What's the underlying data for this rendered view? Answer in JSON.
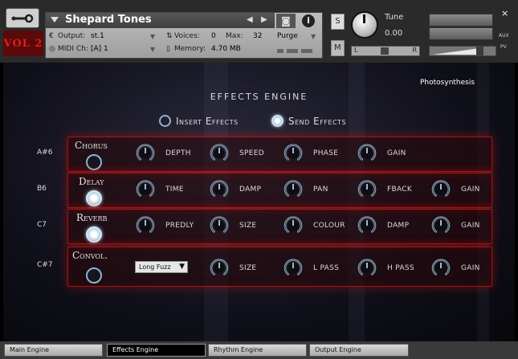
{
  "header": {
    "logo_text": "VOL 2",
    "instrument_name": "Shepard Tones",
    "output_label": "Output:",
    "output_value": "st.1",
    "voices_label": "Voices:",
    "voices_value": "0",
    "max_label": "Max:",
    "max_value": "32",
    "purge_label": "Purge",
    "midi_label": "MIDI Ch:",
    "midi_value": "[A]  1",
    "memory_label": "Memory:",
    "memory_value": "4.70 MB",
    "solo_label": "S",
    "mute_label": "M",
    "tune_label": "Tune",
    "tune_value": "0.00",
    "pan_left": "L",
    "pan_right": "R",
    "aux_label": "AUX",
    "pv_label": "PV",
    "close_glyph": "×"
  },
  "main": {
    "brand": "Photosynthesis",
    "title": "EFFECTS ENGINE",
    "insert_label": "Insert Effects",
    "send_label": "Send Effects",
    "selected_mode": "send",
    "rows": [
      {
        "note": "A#6",
        "name": "Chorus",
        "enabled": false,
        "params": [
          "DEPTH",
          "SPEED",
          "PHASE",
          "GAIN"
        ]
      },
      {
        "note": "B6",
        "name": "Delay",
        "enabled": true,
        "params": [
          "TIME",
          "DAMP",
          "PAN",
          "FBACK",
          "GAIN"
        ]
      },
      {
        "note": "C7",
        "name": "Reverb",
        "enabled": true,
        "params": [
          "PREDLY",
          "SIZE",
          "COLOUR",
          "DAMP",
          "GAIN"
        ]
      },
      {
        "note": "C#7",
        "name": "Convol.",
        "enabled": false,
        "ir_preset": "Long Fuzz",
        "params": [
          "SIZE",
          "L PASS",
          "H PASS",
          "GAIN"
        ]
      }
    ]
  },
  "tabs": [
    "Main Engine",
    "Effects Engine",
    "Rhythm Engine",
    "Output Engine"
  ],
  "active_tab": "Effects Engine",
  "colors": {
    "accent_red": "#c01e1e",
    "knob_ring": "#8eb2cc",
    "logo_red": "#e21b1b"
  }
}
